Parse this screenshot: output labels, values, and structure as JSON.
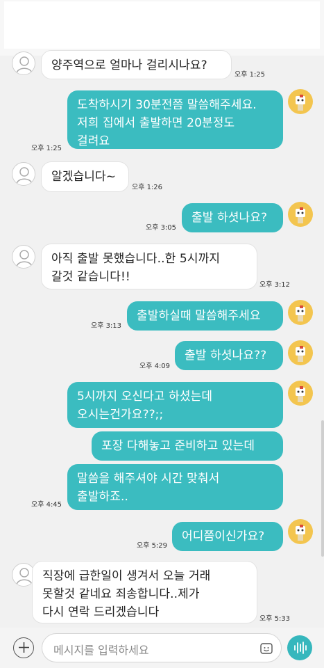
{
  "messages": [
    {
      "sender": "them",
      "text": "양주역으로 얼마나 걸리시나요?",
      "time": "오후 1:25"
    },
    {
      "sender": "me",
      "text": "도착하시기 30분전쯤 말씀해주세요.\n저희 집에서  출발하면 20분정도\n걸려요",
      "time": "오후 1:25"
    },
    {
      "sender": "them",
      "text": "알겠습니다~",
      "time": "오후 1:26"
    },
    {
      "sender": "me",
      "text": "출발 하셧나요?",
      "time": "오후 3:05"
    },
    {
      "sender": "them",
      "text": "아직 출발 못했습니다..한 5시까지\n갈것 같습니다!!",
      "time": "오후 3:12"
    },
    {
      "sender": "me",
      "text": "출발하실때 말씀해주세요",
      "time": "오후 3:13"
    },
    {
      "sender": "me",
      "text": "출발 하셧나요??",
      "time": "오후 4:09"
    },
    {
      "sender": "me",
      "text": "5시까지 오신다고 하셨는데\n오시는건가요??;;",
      "time": ""
    },
    {
      "sender": "me",
      "text": "포장 다해놓고  준비하고 있는데",
      "time": ""
    },
    {
      "sender": "me",
      "text": "말씀을 해주셔야   시간 맞춰서\n출발하죠..",
      "time": "오후 4:45"
    },
    {
      "sender": "me",
      "text": "어디쯤이신가요?",
      "time": "오후 5:29"
    },
    {
      "sender": "them",
      "text": "직장에 급한일이 생겨서 오늘 거래\n못할것 같네요 죄송합니다..제가\n다시 연락 드리겠습니다",
      "time": "오후 5:33"
    }
  ],
  "input": {
    "placeholder": "메시지를 입력하세요"
  },
  "icons": {
    "attach": "plus-icon",
    "emoji": "emoji-icon",
    "voice": "voice-wave-icon",
    "contact_avatar": "person-outline-icon",
    "my_avatar": "character-avatar-icon"
  },
  "colors": {
    "outgoing": "#3bbcc0",
    "incoming": "#ffffff",
    "background": "#f1f1f1",
    "accent": "#36b7bd"
  }
}
